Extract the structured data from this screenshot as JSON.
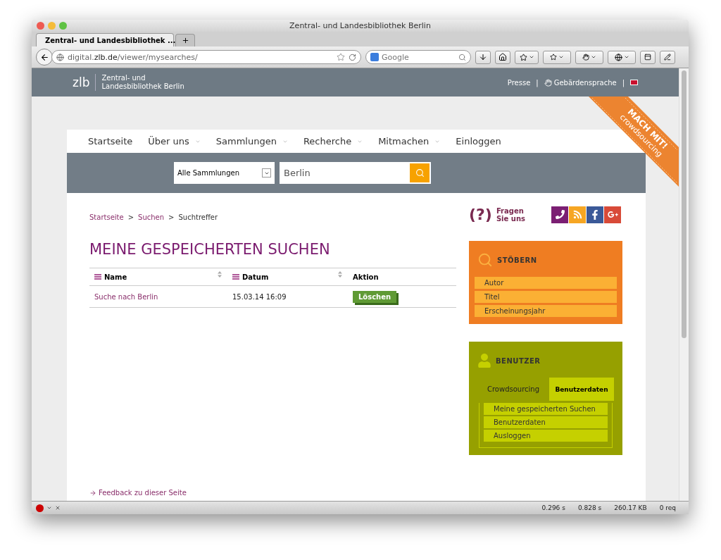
{
  "window": {
    "title": "Zentral- und Landesbibliothek Berlin"
  },
  "tabs": [
    {
      "label": "Zentral- und Landesbibliothek ...",
      "selected": true
    }
  ],
  "toolbar": {
    "url": "digital.**zlb.de**/viewer/mysearches/",
    "search_engine_placeholder": "Google"
  },
  "header": {
    "logo_mark": "zlb",
    "logo_lines": [
      "Zentral- und",
      "Landesbibliothek Berlin"
    ],
    "links": [
      {
        "kind": "link",
        "label": "Presse"
      },
      {
        "kind": "separator",
        "label": "|"
      },
      {
        "kind": "sign-link",
        "label": "Gebärdensprache"
      },
      {
        "kind": "separator",
        "label": "|"
      },
      {
        "kind": "flag"
      }
    ]
  },
  "ribbon": {
    "title": "MACH MIT!",
    "subtitle": "crowdsourcing"
  },
  "nav": [
    {
      "label": "Startseite",
      "dropdown": false
    },
    {
      "label": "Über uns",
      "dropdown": true
    },
    {
      "label": "Sammlungen",
      "dropdown": true
    },
    {
      "label": "Recherche",
      "dropdown": true
    },
    {
      "label": "Mitmachen",
      "dropdown": true
    },
    {
      "label": "Einloggen",
      "dropdown": false
    }
  ],
  "search": {
    "scope": "Alle Sammlungen",
    "value": "Berlin"
  },
  "breadcrumb": [
    {
      "kind": "link",
      "label": "Startseite"
    },
    {
      "kind": "separator",
      "label": ">"
    },
    {
      "kind": "link",
      "label": "Suchen"
    },
    {
      "kind": "separator",
      "label": ">"
    },
    {
      "kind": "current",
      "label": "Suchtreffer"
    }
  ],
  "heading": "MEINE GESPEICHERTEN SUCHEN",
  "table": {
    "columns": [
      {
        "label": "Name",
        "sortable": true
      },
      {
        "label": "Datum",
        "sortable": true
      },
      {
        "label": "Aktion",
        "sortable": false
      }
    ],
    "rows": [
      {
        "name": "Suche nach Berlin",
        "date": "15.03.14 16:09",
        "action": "Löschen"
      }
    ]
  },
  "feedback_link": "Feedback zu dieser Seite",
  "sidebar": {
    "ask": {
      "mark": "(?)",
      "lines": [
        "Fragen",
        "Sie uns"
      ]
    },
    "browse": {
      "title": "STÖBERN",
      "items": [
        "Autor",
        "Titel",
        "Erscheinungsjahr"
      ]
    },
    "user": {
      "title": "BENUTZER",
      "tabs": [
        {
          "label": "Crowdsourcing",
          "selected": false
        },
        {
          "label": "Benutzerdaten",
          "selected": true
        }
      ],
      "items": [
        "Meine gespeicherten Suchen",
        "Benutzerdaten",
        "Ausloggen"
      ]
    }
  },
  "status_bar": {
    "timings": [
      "0.296 s",
      "0.828 s",
      "260.17 KB",
      "0 req"
    ]
  }
}
